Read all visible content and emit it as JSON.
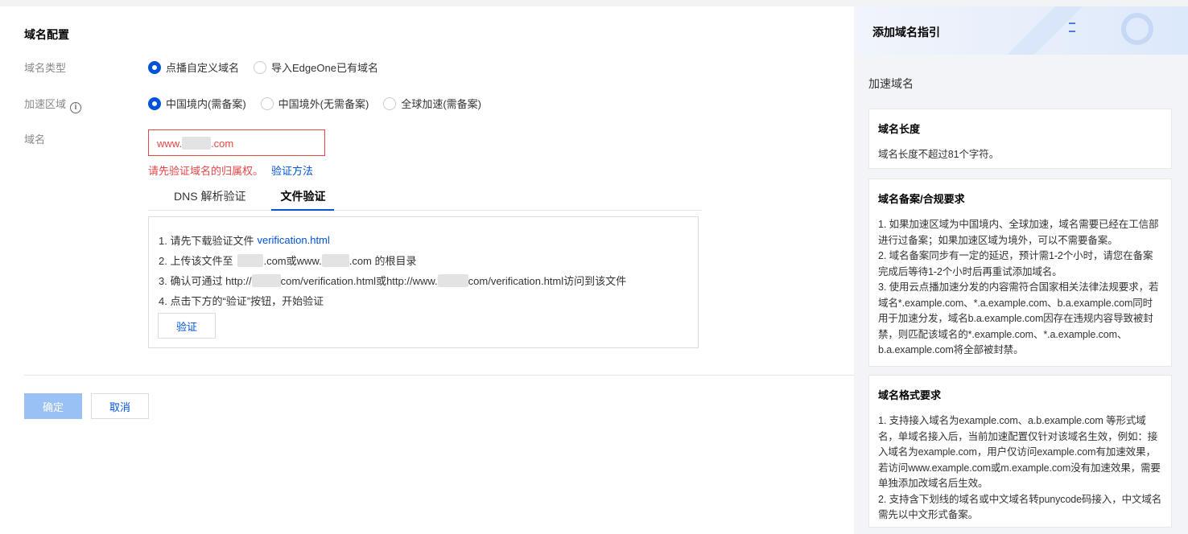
{
  "form": {
    "section_title": "域名配置",
    "domain_type": {
      "label": "域名类型",
      "options": [
        {
          "label": "点播自定义域名",
          "checked": true
        },
        {
          "label": "导入EdgeOne已有域名",
          "checked": false
        }
      ]
    },
    "region": {
      "label": "加速区域",
      "info_icon": "i",
      "options": [
        {
          "label": "中国境内(需备案)",
          "checked": true
        },
        {
          "label": "中国境外(无需备案)",
          "checked": false
        },
        {
          "label": "全球加速(需备案)",
          "checked": false
        }
      ]
    },
    "domain": {
      "label": "域名",
      "value_prefix": "www.",
      "value_suffix": ".com",
      "error": "请先验证域名的归属权。",
      "error_link": "验证方法"
    },
    "tabs": [
      {
        "label": "DNS 解析验证",
        "active": false
      },
      {
        "label": "文件验证",
        "active": true
      }
    ],
    "steps": {
      "s1_text": "1. 请先下载验证文件",
      "s1_link": "verification.html",
      "s2_a": "2. 上传该文件至",
      "s2_b": ".com或www.",
      "s2_c": ".com 的根目录",
      "s3_a": "3. 确认可通过 http://",
      "s3_b": "com/verification.html或http://www.",
      "s3_c": "com/verification.html访问到该文件",
      "s4": "4. 点击下方的“验证”按钮，开始验证"
    },
    "verify_button": "验证",
    "confirm_button": "确定",
    "cancel_button": "取消"
  },
  "guide": {
    "title": "添加域名指引",
    "subtitle": "加速域名",
    "cards": [
      {
        "title": "域名长度",
        "body": "域名长度不超过81个字符。"
      },
      {
        "title": "域名备案/合规要求",
        "body": "1. 如果加速区域为中国境内、全球加速，域名需要已经在工信部进行过备案；如果加速区域为境外，可以不需要备案。\n2. 域名备案同步有一定的延迟，预计需1-2个小时，请您在备案完成后等待1-2个小时后再重试添加域名。\n3. 使用云点播加速分发的内容需符合国家相关法律法规要求，若域名*.example.com、*.a.example.com、b.a.example.com同时用于加速分发，域名b.a.example.com因存在违规内容导致被封禁，则匹配该域名的*.example.com、*.a.example.com、b.a.example.com将全部被封禁。"
      },
      {
        "title": "域名格式要求",
        "body": "1. 支持接入域名为example.com、a.b.example.com 等形式域名，单域名接入后，当前加速配置仅针对该域名生效，例如：接入域名为example.com，用户仅访问example.com有加速效果，若访问www.example.com或m.example.com没有加速效果，需要单独添加改域名后生效。\n2. 支持含下划线的域名或中文域名转punycode码接入，中文域名需先以中文形式备案。"
      }
    ]
  }
}
